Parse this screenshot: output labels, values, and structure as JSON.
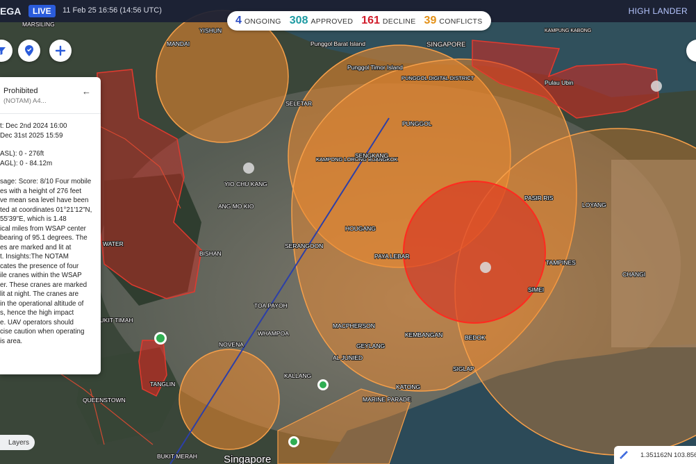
{
  "header": {
    "brand": "EGA",
    "live": "LIVE",
    "datetime": "11 Feb 25 16:56 (14:56 UTC)",
    "operator": "HIGH LANDER"
  },
  "stats": [
    {
      "value": "4",
      "label": "ONGOING",
      "color": "#2b4cc4"
    },
    {
      "value": "308",
      "label": "APPROVED",
      "color": "#1c9aa2"
    },
    {
      "value": "161",
      "label": "DECLINE",
      "color": "#d01b2a"
    },
    {
      "value": "39",
      "label": "CONFLICTS",
      "color": "#e39016"
    }
  ],
  "map_controls": [
    "filter-icon",
    "location-pin-icon",
    "plus-icon"
  ],
  "panel": {
    "title": "Prohibited",
    "subtitle": "(NOTAM) A4...",
    "lines": [
      "t: Dec 2nd 2024 16:00",
      " Dec 31st 2025 15:59",
      "",
      "ASL): 0 - 276ft",
      "AGL): 0 - 84.12m",
      "",
      "sage: Score: 8/10 Four mobile",
      "es with a height of 276 feet",
      "ve mean sea level have been",
      "ted at coordinates 01°21'12\"N,",
      "55'39\"E, which is 1.48",
      "ical miles from WSAP center",
      "bearing of 95.1 degrees. The",
      "es are marked and lit at",
      "t. Insights:The NOTAM",
      "cates the presence of four",
      "ile cranes within the WSAP",
      "er. These cranes are marked",
      "lit at night. The cranes are",
      "in the operational altitude of",
      "s, hence the high impact",
      "e. UAV operators should",
      "cise caution when operating",
      "is area."
    ]
  },
  "layers_label": "Layers",
  "coords": {
    "lat": "1.351162N",
    "lon": "103.856"
  },
  "map": {
    "place_labels": [
      "MARSILING",
      "YISHUN",
      "MANDAI",
      "Punggol Barat Island",
      "Punggol Timor Island",
      "SINGAPORE",
      "KAMPUNG KABONG",
      "PUNGGOL DIGITAL DISTRICT",
      "Pulau Ubin",
      "SELETAR",
      "PUNGGOL",
      "KAMPONG LORONG BUANGKOK",
      "SENGKANG",
      "YIO CHU KANG",
      "ANG MO KIO",
      "PASIR RIS",
      "LOYANG",
      "HOUGANG",
      "BISHAN",
      "SERANGOON",
      "PAYA LEBAR",
      "TAMPINES",
      "SIMEI",
      "CHANGI",
      "TOA PAYOH",
      "BUKIT TIMAH",
      "NOVENA",
      "WHAMPOA",
      "MACPHERSON",
      "GEYLANG",
      "AL JUNIED",
      "KEMBANGAN",
      "BEDOK",
      "SIGLAP",
      "KATONG",
      "TANGLIN",
      "KALLANG",
      "MARINE PARADE",
      "QUEENSTOWN",
      "BUKIT MERAH",
      "Singapore",
      "WATER"
    ],
    "colors": {
      "orange_zone": "#f08a2e",
      "red_zone": "#d8281f",
      "land": "#3d4a3e",
      "urban": "#8a7e70",
      "sea": "#2e4a55"
    }
  }
}
